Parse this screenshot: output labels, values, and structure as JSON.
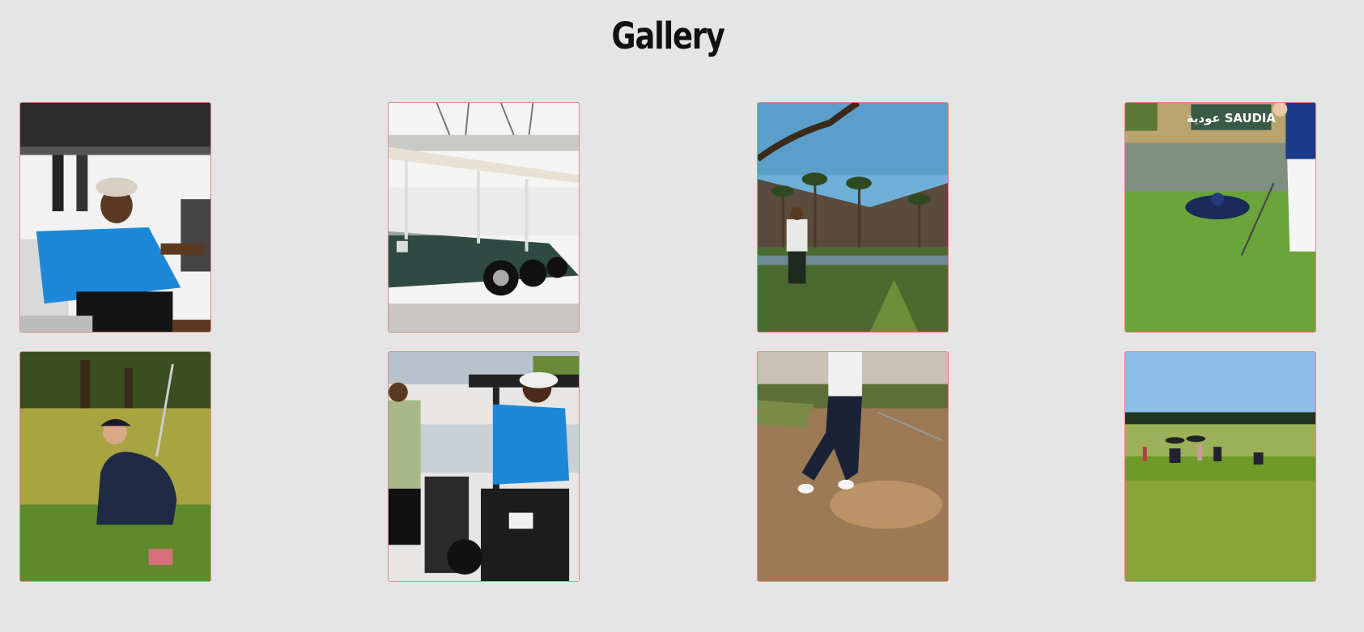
{
  "page": {
    "title": "Gallery"
  },
  "gallery": {
    "images": [
      {
        "id": "photo-golfer-cart-smiling",
        "alt": "smiling golfer in blue shirt sitting in golf cart"
      },
      {
        "id": "photo-golf-carts-row",
        "alt": "row of green golf carts"
      },
      {
        "id": "photo-palm-course",
        "alt": "golfer on course with palm trees and mountains"
      },
      {
        "id": "photo-putting-green-saudia",
        "alt": "golfer putting on green with SAUDIA sign"
      },
      {
        "id": "photo-golfer-bunker-shot",
        "alt": "golfer hitting from rough"
      },
      {
        "id": "photo-golfers-with-cart",
        "alt": "two golfers beside golf cart with bags"
      },
      {
        "id": "photo-sand-bunker-swing",
        "alt": "golfer swinging out of sand bunker"
      },
      {
        "id": "photo-links-course-players",
        "alt": "players with trolleys on links course"
      }
    ],
    "saudia_sign": "عودية SAUDIA"
  }
}
